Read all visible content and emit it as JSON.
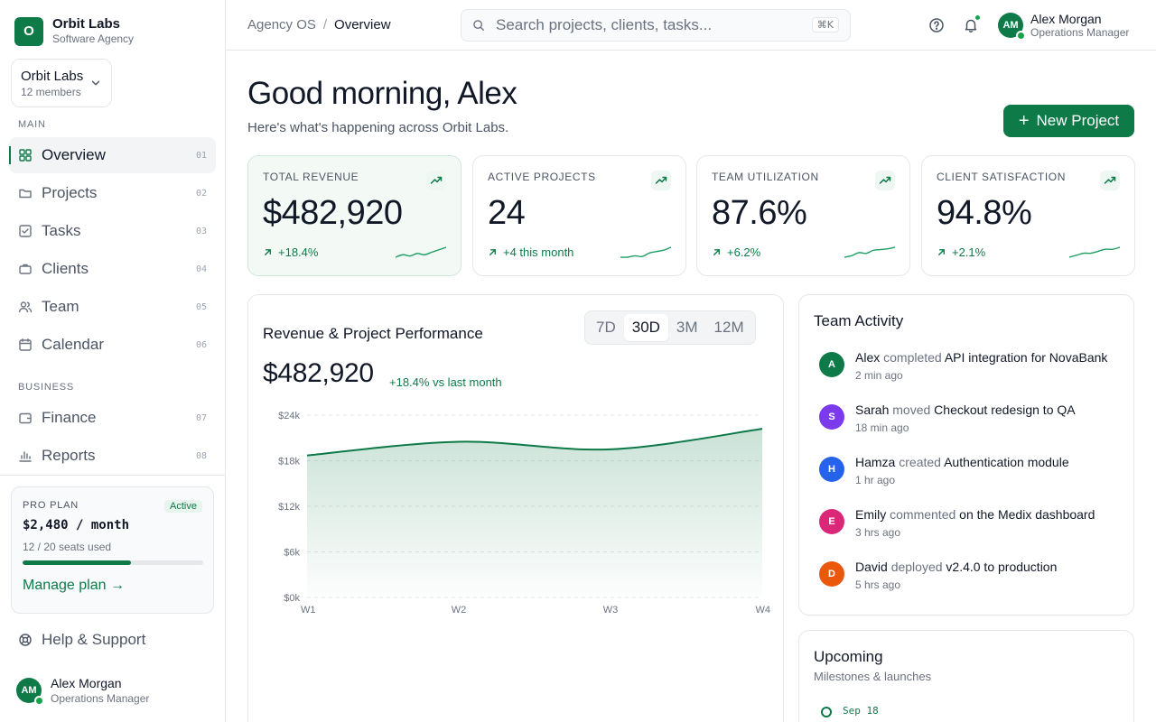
{
  "brand": {
    "logo_letter": "O",
    "name": "Orbit Labs",
    "subtitle": "Software Agency"
  },
  "workspace": {
    "name": "Orbit Labs",
    "members": "12 members"
  },
  "sidebar": {
    "main_label": "MAIN",
    "business_label": "BUSINESS",
    "items": [
      {
        "label": "Overview",
        "num": "01",
        "icon": "grid-icon",
        "active": true
      },
      {
        "label": "Projects",
        "num": "02",
        "icon": "folder-icon"
      },
      {
        "label": "Tasks",
        "num": "03",
        "icon": "checkbox-icon"
      },
      {
        "label": "Clients",
        "num": "04",
        "icon": "briefcase-icon"
      },
      {
        "label": "Team",
        "num": "05",
        "icon": "users-icon"
      },
      {
        "label": "Calendar",
        "num": "06",
        "icon": "calendar-icon"
      },
      {
        "label": "Finance",
        "num": "07",
        "icon": "wallet-icon"
      },
      {
        "label": "Reports",
        "num": "08",
        "icon": "bar-chart-icon"
      }
    ],
    "plan": {
      "label": "PRO PLAN",
      "badge": "Active",
      "price": "$2,480 / month",
      "seats": "12 / 20 seats used",
      "seats_fraction": 0.6,
      "link": "Manage plan →"
    },
    "help": "Help & Support",
    "user": {
      "initials": "AM",
      "name": "Alex Morgan",
      "role": "Operations Manager"
    }
  },
  "topbar": {
    "breadcrumb_root": "Agency OS",
    "breadcrumb_sep": "/",
    "breadcrumb_current": "Overview",
    "search_placeholder": "Search projects, clients, tasks...",
    "search_shortcut": "⌘K",
    "user": {
      "initials": "AM",
      "name": "Alex Morgan",
      "role": "Operations Manager"
    }
  },
  "header": {
    "greeting": "Good morning, Alex",
    "subtitle": "Here's what's happening across Orbit Labs.",
    "new_project_label": "New Project"
  },
  "kpis": [
    {
      "label": "TOTAL REVENUE",
      "value": "$482,920",
      "change": "+18.4%",
      "trend": [
        3,
        4,
        3.5,
        4.5,
        4,
        5,
        6,
        7
      ]
    },
    {
      "label": "ACTIVE PROJECTS",
      "value": "24",
      "change": "+4 this month",
      "trend": [
        4,
        4,
        4.2,
        4.1,
        4.6,
        4.8,
        5,
        5.4
      ]
    },
    {
      "label": "TEAM UTILIZATION",
      "value": "87.6%",
      "change": "+6.2%",
      "trend": [
        4,
        4.2,
        4.6,
        4.5,
        4.9,
        5,
        5.1,
        5.3
      ]
    },
    {
      "label": "CLIENT SATISFACTION",
      "value": "94.8%",
      "change": "+2.1%",
      "trend": [
        4.6,
        4.7,
        4.8,
        4.8,
        4.9,
        5,
        5,
        5.1
      ]
    }
  ],
  "chart": {
    "title": "Revenue & Project Performance",
    "ranges": [
      "7D",
      "30D",
      "3M",
      "12M"
    ],
    "active_range": "30D",
    "total": "$482,920",
    "delta": "+18.4% vs last month"
  },
  "chart_data": {
    "type": "area",
    "x": [
      "W1",
      "W2",
      "W3",
      "W4"
    ],
    "xlabel": "",
    "ylabel": "",
    "ylim": [
      0,
      24000
    ],
    "yticks": [
      "$0k",
      "$6k",
      "$12k",
      "$18k",
      "$24k"
    ],
    "series": [
      {
        "values": [
          18700,
          20500,
          19500,
          22200
        ]
      }
    ],
    "grid": true,
    "accent": "#0e7a48"
  },
  "activity": {
    "title": "Team Activity",
    "items": [
      {
        "initial": "A",
        "name": "Alex",
        "verb": "completed",
        "object": "API integration for NovaBank",
        "time": "2 min ago",
        "color": "#0e7a48"
      },
      {
        "initial": "S",
        "name": "Sarah",
        "verb": "moved",
        "object": "Checkout redesign to QA",
        "time": "18 min ago",
        "color": "#7c3aed"
      },
      {
        "initial": "H",
        "name": "Hamza",
        "verb": "created",
        "object": "Authentication module",
        "time": "1 hr ago",
        "color": "#2563eb"
      },
      {
        "initial": "E",
        "name": "Emily",
        "verb": "commented",
        "object": "on the Medix dashboard",
        "time": "3 hrs ago",
        "color": "#db2777"
      },
      {
        "initial": "D",
        "name": "David",
        "verb": "deployed",
        "object": "v2.4.0 to production",
        "time": "5 hrs ago",
        "color": "#ea580c"
      }
    ]
  },
  "upcoming": {
    "title": "Upcoming",
    "subtitle": "Milestones & launches",
    "first_date": "Sep 18"
  }
}
